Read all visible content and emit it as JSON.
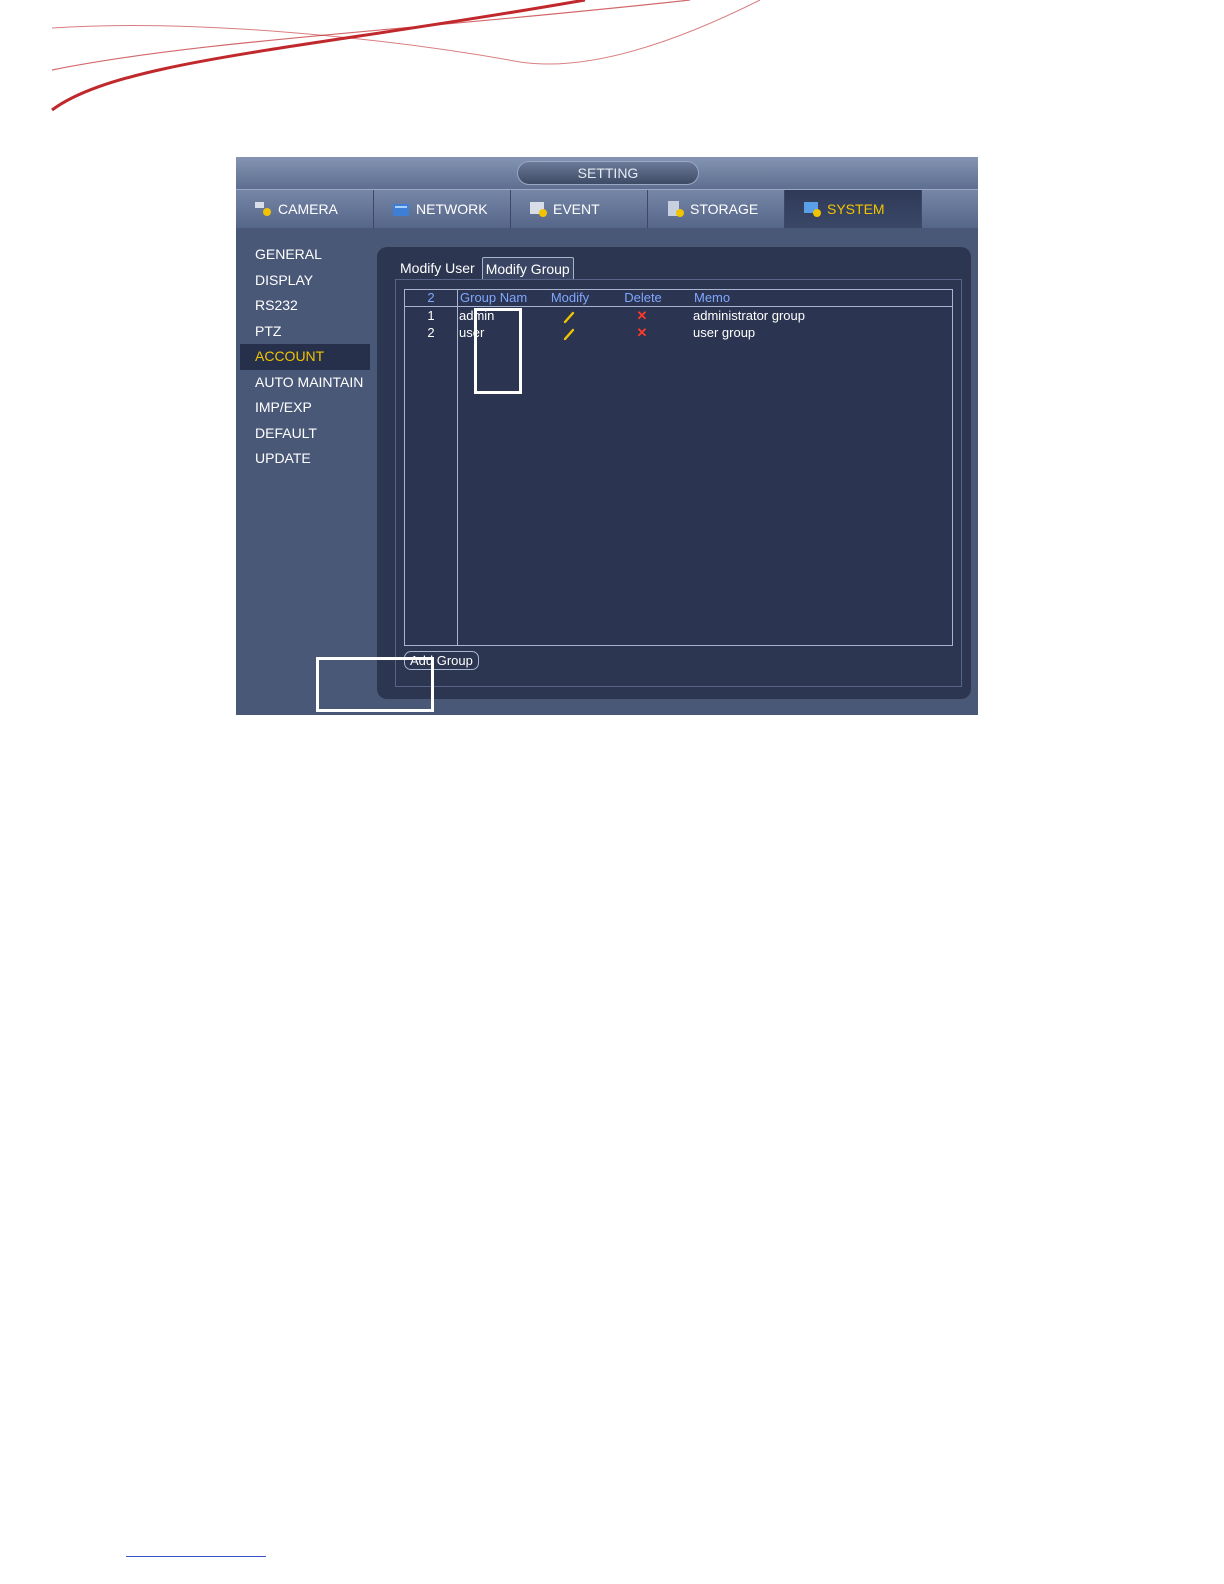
{
  "window": {
    "title": "SETTING"
  },
  "tabs": [
    {
      "label": "CAMERA",
      "icon": "camera-gear-icon",
      "active": false
    },
    {
      "label": "NETWORK",
      "icon": "network-icon",
      "active": false
    },
    {
      "label": "EVENT",
      "icon": "event-gear-icon",
      "active": false
    },
    {
      "label": "STORAGE",
      "icon": "storage-gear-icon",
      "active": false
    },
    {
      "label": "SYSTEM",
      "icon": "system-gear-icon",
      "active": true
    }
  ],
  "menu": {
    "items": [
      "GENERAL",
      "DISPLAY",
      "RS232",
      "PTZ",
      "ACCOUNT",
      "AUTO MAINTAIN",
      "IMP/EXP",
      "DEFAULT",
      "UPDATE"
    ],
    "active": "ACCOUNT"
  },
  "subtabs": {
    "modify_user": "Modify User",
    "modify_group": "Modify Group"
  },
  "table": {
    "headers": {
      "count": "2",
      "group_name": "Group Nam",
      "modify": "Modify",
      "delete": "Delete",
      "memo": "Memo"
    },
    "rows": [
      {
        "index": "1",
        "name": "admin",
        "memo": "administrator group",
        "delete": "✕"
      },
      {
        "index": "2",
        "name": "user",
        "memo": "user group",
        "delete": "✕"
      }
    ]
  },
  "buttons": {
    "add_group": "Add Group"
  },
  "colors": {
    "accent": "#f2c400",
    "delete": "#ff3a2a",
    "header_text": "#7fa7ff"
  }
}
